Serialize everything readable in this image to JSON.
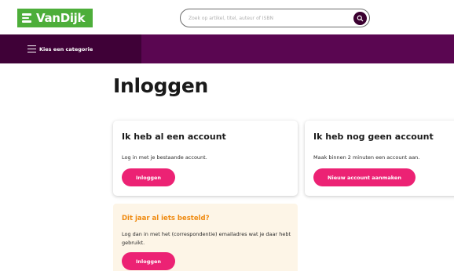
{
  "brand": {
    "name": "VanDijk",
    "logo_color": "#4dae3a"
  },
  "search": {
    "placeholder": "Zoek op artikel, titel, auteur of ISBN",
    "icon": "search-icon"
  },
  "nav": {
    "category_label": "Kies een categorie",
    "icon": "hamburger-menu-icon",
    "bar_color": "#5a0651"
  },
  "main": {
    "title": "Inloggen",
    "accent_color": "#ec2274",
    "cards": [
      {
        "title": "Ik heb al een account",
        "text": "Log in met je bestaande account.",
        "button": "Inloggen"
      },
      {
        "title": "Ik heb nog geen account",
        "text": "Maak binnen 2 minuten een account aan.",
        "button": "Nieuw account aanmaken"
      },
      {
        "title": "Dit jaar al iets besteld?",
        "text": "Log dan in met het (correspondentie) emailadres wat je daar hebt gebruikt.",
        "button": "Inloggen",
        "title_color": "#ef8a10",
        "background": "#fdf5e7"
      }
    ]
  }
}
